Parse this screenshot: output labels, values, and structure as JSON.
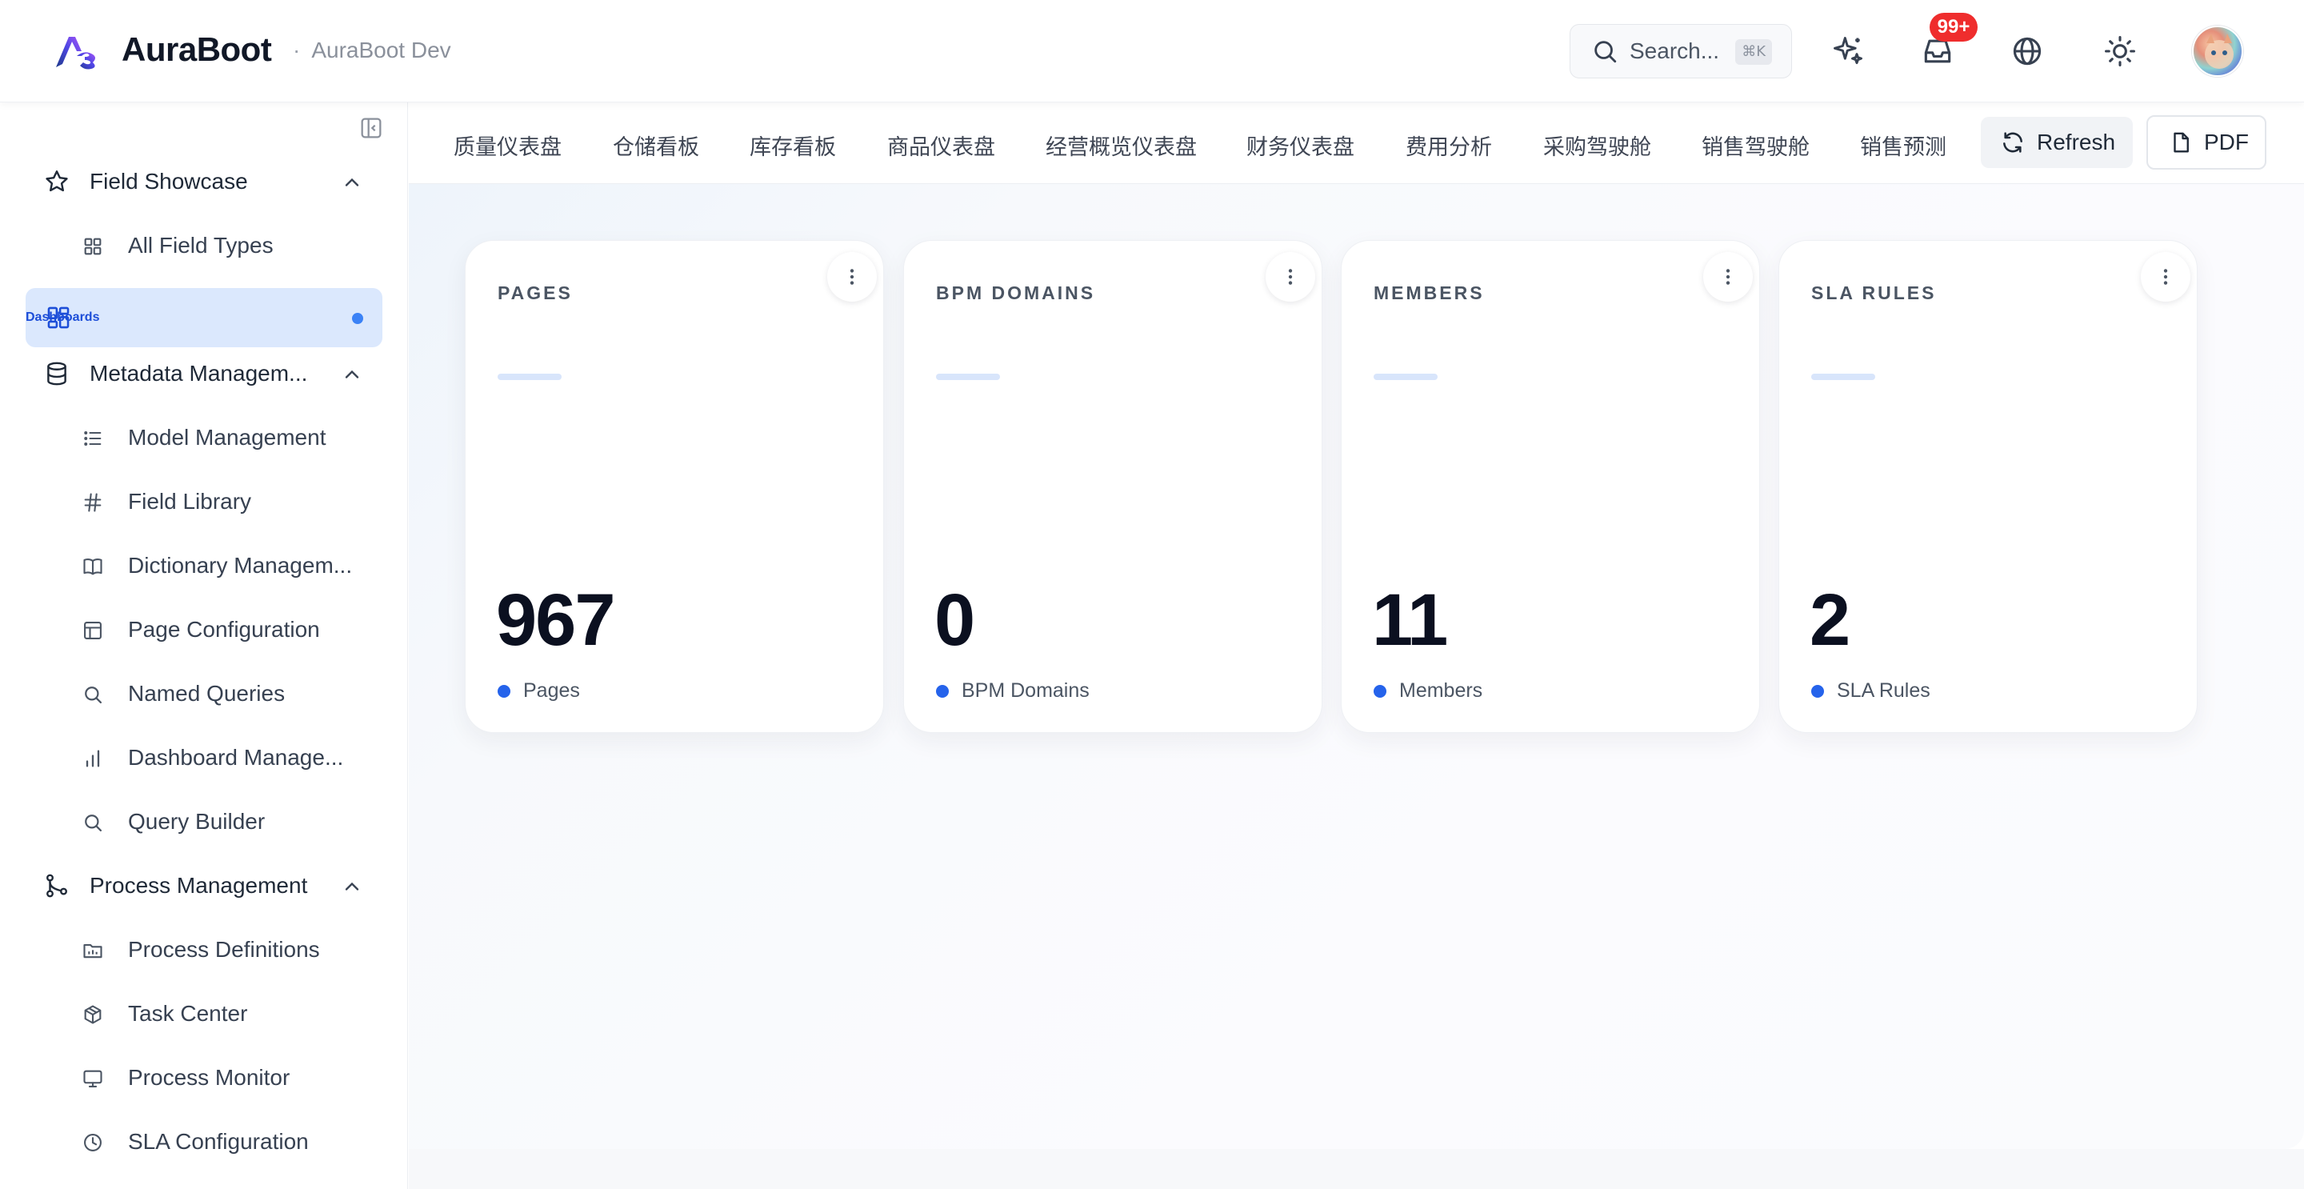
{
  "app": {
    "name": "AuraBoot",
    "environment": "AuraBoot Dev",
    "separator": "·"
  },
  "header": {
    "search_placeholder": "Search...",
    "search_shortcut": "⌘K",
    "notification_count": "99+",
    "icons": [
      "sparkles-icon",
      "inbox-icon",
      "globe-icon",
      "sun-icon"
    ]
  },
  "sidebar": {
    "items": [
      {
        "label": "Field Showcase",
        "type": "parent",
        "icon": "star-icon",
        "expanded": true
      },
      {
        "label": "All Field Types",
        "type": "child",
        "icon": "grid-icon"
      },
      {
        "label": "Dashboards",
        "type": "active",
        "icon": "dashboard-icon"
      },
      {
        "label": "Metadata Managem...",
        "type": "parent",
        "icon": "database-icon",
        "expanded": true
      },
      {
        "label": "Model Management",
        "type": "child",
        "icon": "list-icon"
      },
      {
        "label": "Field Library",
        "type": "child",
        "icon": "hash-icon"
      },
      {
        "label": "Dictionary Managem...",
        "type": "child",
        "icon": "book-icon"
      },
      {
        "label": "Page Configuration",
        "type": "child",
        "icon": "layout-icon"
      },
      {
        "label": "Named Queries",
        "type": "child",
        "icon": "search-icon"
      },
      {
        "label": "Dashboard Manage...",
        "type": "child",
        "icon": "bar-chart-icon"
      },
      {
        "label": "Query Builder",
        "type": "child",
        "icon": "search-icon"
      },
      {
        "label": "Process Management",
        "type": "parent",
        "icon": "git-branch-icon",
        "expanded": true
      },
      {
        "label": "Process Definitions",
        "type": "child",
        "icon": "folder-icon"
      },
      {
        "label": "Task Center",
        "type": "child",
        "icon": "package-icon"
      },
      {
        "label": "Process Monitor",
        "type": "child",
        "icon": "monitor-icon"
      },
      {
        "label": "SLA Configuration",
        "type": "child",
        "icon": "clock-icon"
      }
    ]
  },
  "tabs": [
    "质量仪表盘",
    "仓储看板",
    "库存看板",
    "商品仪表盘",
    "经营概览仪表盘",
    "财务仪表盘",
    "费用分析",
    "采购驾驶舱",
    "销售驾驶舱",
    "销售预测"
  ],
  "toolbar": {
    "refresh_label": "Refresh",
    "pdf_label": "PDF"
  },
  "cards": [
    {
      "title": "PAGES",
      "value": "967",
      "legend": "Pages"
    },
    {
      "title": "BPM DOMAINS",
      "value": "0",
      "legend": "BPM Domains"
    },
    {
      "title": "MEMBERS",
      "value": "11",
      "legend": "Members"
    },
    {
      "title": "SLA RULES",
      "value": "2",
      "legend": "SLA Rules"
    }
  ],
  "colors": {
    "accent": "#2563eb",
    "active_bg": "#dbe8fd",
    "badge": "#ef2d2d"
  }
}
